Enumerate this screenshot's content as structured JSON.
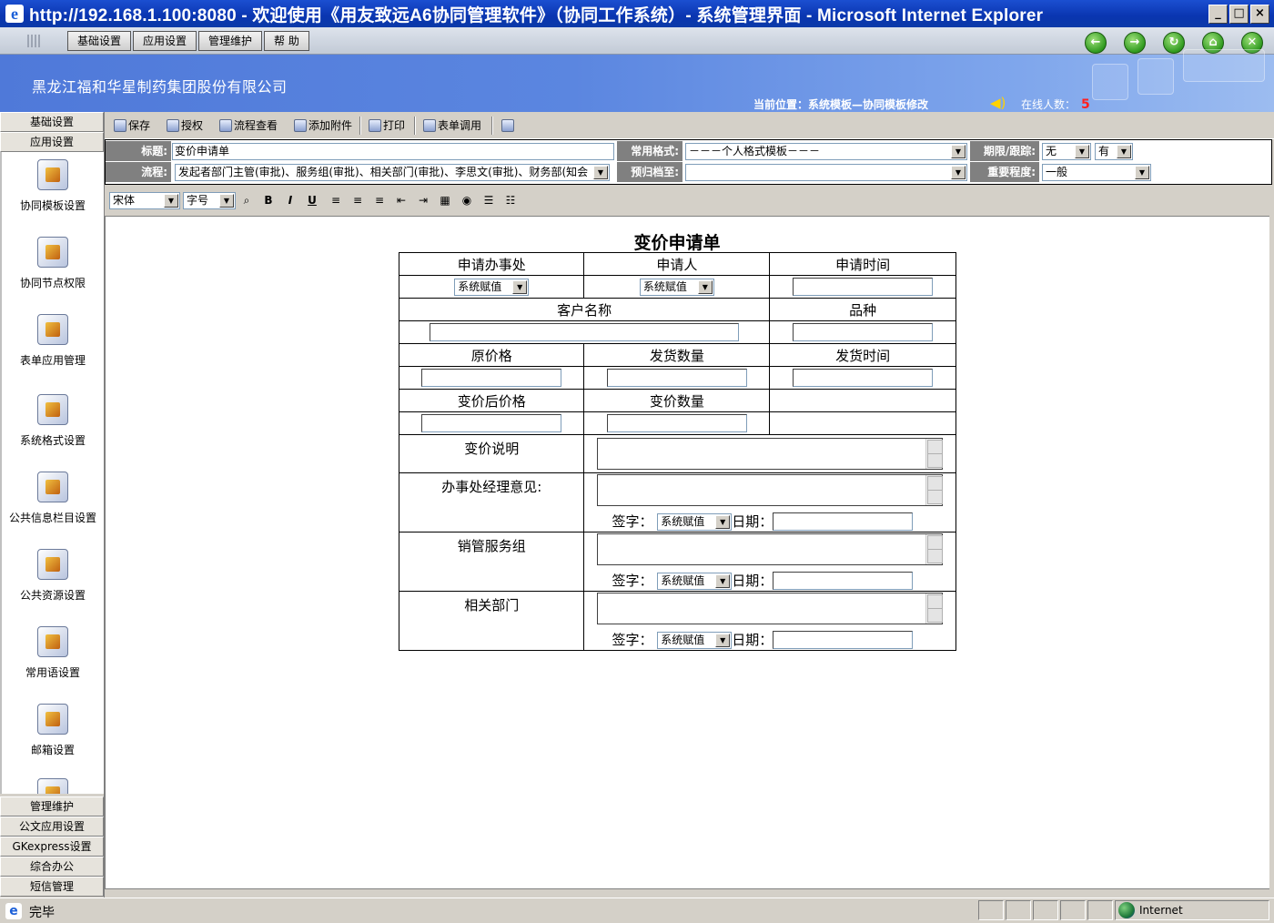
{
  "window": {
    "title": "http://192.168.1.100:8080 - 欢迎使用《用友致远A6协同管理软件》（协同工作系统）- 系统管理界面 - Microsoft Internet Explorer",
    "buttons": [
      "_",
      "□",
      "×"
    ]
  },
  "menu": {
    "items": [
      "基础设置",
      "应用设置",
      "管理维护",
      "帮 助"
    ]
  },
  "nav_icons": [
    "back-icon",
    "forward-icon",
    "refresh-icon",
    "home-icon",
    "close-icon"
  ],
  "header": {
    "company": "黑龙江福和华星制药集团股份有限公司",
    "location": "当前位置：系统模板—协同模板修改",
    "online_label": "在线人数：",
    "online_count": "5"
  },
  "sidebar": {
    "top_categories": [
      "基础设置",
      "应用设置"
    ],
    "items": [
      {
        "label": "协同模板设置",
        "icon": "template-icon"
      },
      {
        "label": "协同节点权限",
        "icon": "node-permission-icon"
      },
      {
        "label": "表单应用管理",
        "icon": "form-app-icon"
      },
      {
        "label": "系统格式设置",
        "icon": "format-icon"
      },
      {
        "label": "公共信息栏目设置",
        "icon": "info-column-icon"
      },
      {
        "label": "公共资源设置",
        "icon": "resource-icon"
      },
      {
        "label": "常用语设置",
        "icon": "phrase-icon"
      },
      {
        "label": "邮箱设置",
        "icon": "mailbox-icon"
      }
    ],
    "bottom_categories": [
      "管理维护",
      "公文应用设置",
      "GKexpress设置",
      "综合办公",
      "短信管理"
    ]
  },
  "toolbar": {
    "save": "保存",
    "authorize": "授权",
    "flow_view": "流程查看",
    "attach": "添加附件",
    "print": "打印",
    "form_call": "表单调用"
  },
  "form_header": {
    "title_label": "标题:",
    "title_value": "变价申请单",
    "flow_label": "流程:",
    "flow_value": "发起者部门主管(审批)、服务组(审批)、相关部门(审批)、李思文(审批)、财务部(知会",
    "format_label": "常用格式:",
    "format_value": "－－－个人格式模板－－－",
    "archive_label": "预归档至:",
    "archive_value": "",
    "deadline_label": "期限/跟踪:",
    "deadline_value": "无",
    "track_value": "有",
    "importance_label": "重要程度:",
    "importance_value": "一般"
  },
  "editor": {
    "font": "宋体",
    "size": "字号"
  },
  "document": {
    "title": "变价申请单",
    "apply_office": "申请办事处",
    "applicant": "申请人",
    "apply_time": "申请时间",
    "customer_name": "客户名称",
    "variety": "品种",
    "original_price": "原价格",
    "ship_qty": "发货数量",
    "ship_time": "发货时间",
    "new_price": "变价后价格",
    "change_qty": "变价数量",
    "change_desc": "变价说明",
    "office_manager_opinion": "办事处经理意见:",
    "sales_service": "销管服务组",
    "related_dept": "相关部门",
    "sys_value": "系统赋值",
    "sign_label": "签字：",
    "date_label": "日期："
  },
  "statusbar": {
    "text": "完毕",
    "zone": "Internet"
  }
}
